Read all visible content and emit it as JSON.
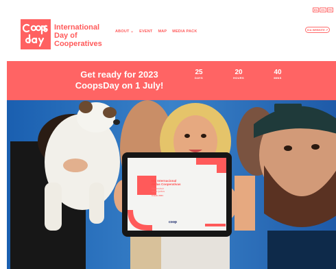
{
  "header": {
    "languages": [
      "EN",
      "ES",
      "FR"
    ],
    "logo_text": "Coops Day",
    "brand_lines": [
      "International",
      "Day of",
      "Cooperatives"
    ],
    "nav": [
      "ABOUT",
      "EVENT",
      "MAP",
      "MEDIA PACK"
    ],
    "about_caret": "⌄",
    "website_button": "ICA WEBSITE ↗"
  },
  "banner": {
    "headline_line1": "Get ready for 2023",
    "headline_line2": "CoopsDay on 1 July!",
    "countdown": [
      {
        "value": "25",
        "label": "DAYS"
      },
      {
        "value": "20",
        "label": "HOURS"
      },
      {
        "value": "40",
        "label": "MINS"
      }
    ]
  },
  "tablet": {
    "title_line1": "Día Internacional",
    "title_line2": "de las Cooperativas",
    "subtitle_line1": "Reconstruir",
    "subtitle_line2": "mejor juntos",
    "date": "3 Julio 2021",
    "footer_logo": "coop"
  },
  "colors": {
    "brand": "#ff5a5a",
    "banner": "#ff6464"
  }
}
